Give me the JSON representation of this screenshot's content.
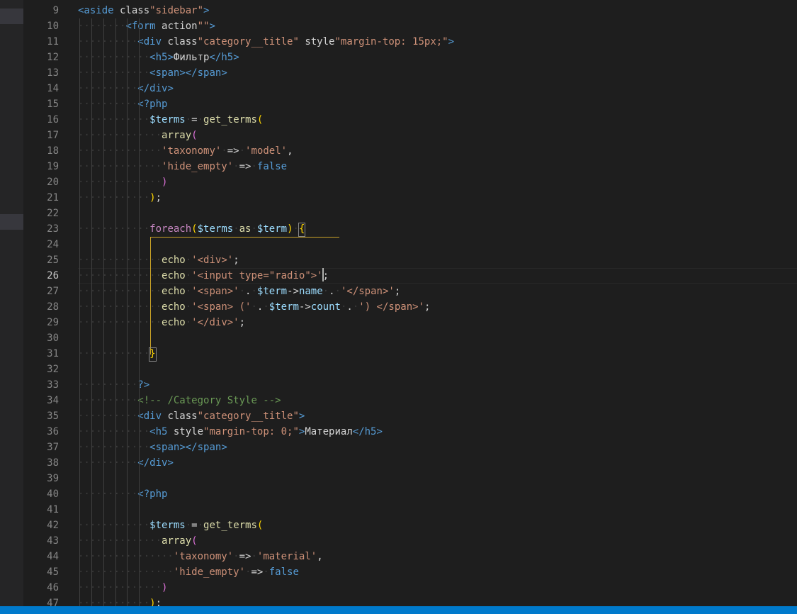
{
  "editor": {
    "language": "php",
    "current_line": 26,
    "status_right": "",
    "lines": [
      {
        "n": "9",
        "text": "<aside class=\"sidebar\">"
      },
      {
        "n": "10",
        "text": "        <form action=\"\">"
      },
      {
        "n": "11",
        "text": "          <div class=\"category__title\" style=\"margin-top: 15px;\">"
      },
      {
        "n": "12",
        "text": "            <h5>Фильтр</h5>"
      },
      {
        "n": "13",
        "text": "            <span></span>"
      },
      {
        "n": "14",
        "text": "          </div>"
      },
      {
        "n": "15",
        "text": "          <?php"
      },
      {
        "n": "16",
        "text": "            $terms = get_terms("
      },
      {
        "n": "17",
        "text": "              array("
      },
      {
        "n": "18",
        "text": "              'taxonomy' => 'model',"
      },
      {
        "n": "19",
        "text": "              'hide_empty' => false"
      },
      {
        "n": "20",
        "text": "              )"
      },
      {
        "n": "21",
        "text": "            );"
      },
      {
        "n": "22",
        "text": ""
      },
      {
        "n": "23",
        "text": "            foreach($terms as $term) {"
      },
      {
        "n": "24",
        "text": ""
      },
      {
        "n": "25",
        "text": "              echo '<div>';"
      },
      {
        "n": "26",
        "text": "              echo '<input type=\"radio\">';"
      },
      {
        "n": "27",
        "text": "              echo '<span>' . $term->name . '</span>';"
      },
      {
        "n": "28",
        "text": "              echo '<span> (' . $term->count . ') </span>';"
      },
      {
        "n": "29",
        "text": "              echo '</div>';"
      },
      {
        "n": "30",
        "text": ""
      },
      {
        "n": "31",
        "text": "            }"
      },
      {
        "n": "32",
        "text": ""
      },
      {
        "n": "33",
        "text": "          ?>"
      },
      {
        "n": "34",
        "text": "          <!-- /Category Style -->"
      },
      {
        "n": "35",
        "text": "          <div class=\"category__title\">"
      },
      {
        "n": "36",
        "text": "            <h5 style=\"margin-top: 0;\">Материал</h5>"
      },
      {
        "n": "37",
        "text": "            <span></span>"
      },
      {
        "n": "38",
        "text": "          </div>"
      },
      {
        "n": "39",
        "text": ""
      },
      {
        "n": "40",
        "text": "          <?php"
      },
      {
        "n": "41",
        "text": ""
      },
      {
        "n": "42",
        "text": "            $terms = get_terms("
      },
      {
        "n": "43",
        "text": "              array("
      },
      {
        "n": "44",
        "text": "                'taxonomy' => 'material',"
      },
      {
        "n": "45",
        "text": "                'hide_empty' => false"
      },
      {
        "n": "46",
        "text": "              )"
      },
      {
        "n": "47",
        "text": "            );"
      }
    ]
  },
  "theme": {
    "background": "#1e1e1e",
    "tag": "#569cd6",
    "attribute": "#9cdcfe",
    "string": "#ce9178",
    "function": "#dcdcaa",
    "keyword": "#c586c0",
    "comment": "#6a9955",
    "bracket_1": "#ffd700",
    "bracket_2": "#da70d6",
    "bracket_3": "#179fff",
    "statusbar": "#007acc"
  }
}
